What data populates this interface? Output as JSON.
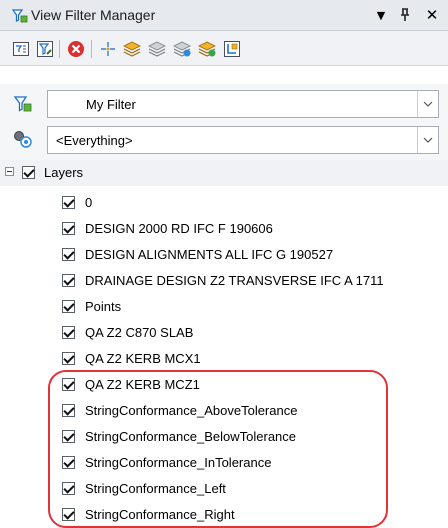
{
  "window": {
    "title": "View Filter Manager"
  },
  "titlebar_buttons": [
    "▼",
    "ᛘ",
    "✕"
  ],
  "toolbar": {
    "tools": [
      "filter-list-icon",
      "filter-edit-icon",
      "delete-icon",
      "crosshair-icon",
      "layer-stack-icon",
      "layer-stack-gray-icon",
      "layer-stack-check-icon",
      "layer-stack-add-icon",
      "layer-filter-icon"
    ]
  },
  "filter_combo": {
    "value": "My Filter"
  },
  "scope_combo": {
    "value": "<Everything>"
  },
  "tree": {
    "root_label": "Layers",
    "items": [
      {
        "label": "0"
      },
      {
        "label": "DESIGN 2000 RD IFC F 190606"
      },
      {
        "label": "DESIGN ALIGNMENTS ALL IFC G 190527"
      },
      {
        "label": "DRAINAGE DESIGN Z2 TRANSVERSE IFC A 1711"
      },
      {
        "label": "Points"
      },
      {
        "label": "QA Z2 C870 SLAB"
      },
      {
        "label": "QA Z2 KERB MCX1"
      },
      {
        "label": "QA Z2 KERB MCZ1"
      },
      {
        "label": "StringConformance_AboveTolerance"
      },
      {
        "label": "StringConformance_BelowTolerance"
      },
      {
        "label": "StringConformance_InTolerance"
      },
      {
        "label": "StringConformance_Left"
      },
      {
        "label": "StringConformance_Right"
      }
    ]
  },
  "colors": {
    "highlight": "#e0333a",
    "accent": "#1b6fc8"
  }
}
